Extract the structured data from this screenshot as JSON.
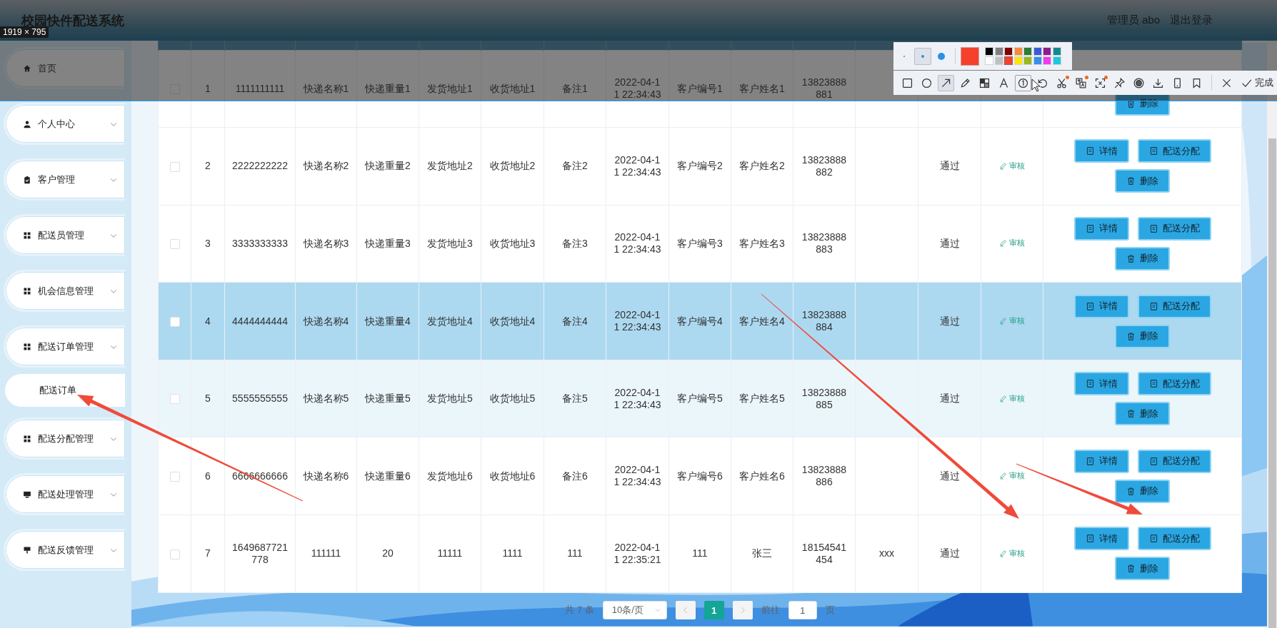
{
  "header": {
    "title": "校园快件配送系统",
    "user": "管理员 abo",
    "logout": "退出登录"
  },
  "sidebar": {
    "items": [
      {
        "label": "首页",
        "kind": "link"
      },
      {
        "label": "个人中心",
        "kind": "submenu"
      },
      {
        "label": "客户管理",
        "kind": "submenu"
      },
      {
        "label": "配送员管理",
        "kind": "submenu"
      },
      {
        "label": "机会信息管理",
        "kind": "submenu"
      },
      {
        "label": "配送订单管理",
        "kind": "submenu",
        "children": [
          {
            "label": "配送订单"
          }
        ]
      },
      {
        "label": "配送分配管理",
        "kind": "submenu"
      },
      {
        "label": "配送处理管理",
        "kind": "submenu"
      },
      {
        "label": "配送反馈管理",
        "kind": "submenu"
      }
    ]
  },
  "table": {
    "rows": [
      {
        "checked": false,
        "selected": false,
        "hover": false,
        "cells": [
          "1",
          "1111111111",
          "快递名称1",
          "快递重量1",
          "发货地址1",
          "收货地址1",
          "备注1",
          "2022-04-11 22:34:43",
          "客户编号1",
          "客户姓名1",
          "13823888881",
          null,
          null
        ],
        "actions": [
          {
            "label": "删除",
            "kind": "delete"
          }
        ]
      },
      {
        "checked": false,
        "selected": false,
        "hover": false,
        "cells": [
          "2",
          "2222222222",
          "快递名称2",
          "快递重量2",
          "发货地址2",
          "收货地址2",
          "备注2",
          "2022-04-11 22:34:43",
          "客户编号2",
          "客户姓名2",
          "13823888882",
          null,
          "通过"
        ],
        "review": "审核",
        "actions": [
          {
            "label": "详情",
            "kind": "detail"
          },
          {
            "label": "配送分配",
            "kind": "assign"
          },
          {
            "label": "删除",
            "kind": "delete"
          }
        ]
      },
      {
        "checked": false,
        "selected": false,
        "hover": false,
        "cells": [
          "3",
          "3333333333",
          "快递名称3",
          "快递重量3",
          "发货地址3",
          "收货地址3",
          "备注3",
          "2022-04-11 22:34:43",
          "客户编号3",
          "客户姓名3",
          "13823888883",
          null,
          "通过"
        ],
        "review": "审核",
        "actions": [
          {
            "label": "详情",
            "kind": "detail"
          },
          {
            "label": "配送分配",
            "kind": "assign"
          },
          {
            "label": "删除",
            "kind": "delete"
          }
        ]
      },
      {
        "checked": false,
        "selected": true,
        "hover": false,
        "cells": [
          "4",
          "4444444444",
          "快递名称4",
          "快递重量4",
          "发货地址4",
          "收货地址4",
          "备注4",
          "2022-04-11 22:34:43",
          "客户编号4",
          "客户姓名4",
          "13823888884",
          null,
          "通过"
        ],
        "review": "审核",
        "actions": [
          {
            "label": "详情",
            "kind": "detail"
          },
          {
            "label": "配送分配",
            "kind": "assign"
          },
          {
            "label": "删除",
            "kind": "delete"
          }
        ]
      },
      {
        "checked": false,
        "selected": false,
        "hover": true,
        "cells": [
          "5",
          "5555555555",
          "快递名称5",
          "快递重量5",
          "发货地址5",
          "收货地址5",
          "备注5",
          "2022-04-11 22:34:43",
          "客户编号5",
          "客户姓名5",
          "13823888885",
          null,
          "通过"
        ],
        "review": "审核",
        "actions": [
          {
            "label": "详情",
            "kind": "detail"
          },
          {
            "label": "配送分配",
            "kind": "assign"
          },
          {
            "label": "删除",
            "kind": "delete"
          }
        ]
      },
      {
        "checked": false,
        "selected": false,
        "hover": false,
        "cells": [
          "6",
          "6666666666",
          "快递名称6",
          "快递重量6",
          "发货地址6",
          "收货地址6",
          "备注6",
          "2022-04-11 22:34:43",
          "客户编号6",
          "客户姓名6",
          "13823888886",
          null,
          "通过"
        ],
        "review": "审核",
        "actions": [
          {
            "label": "详情",
            "kind": "detail"
          },
          {
            "label": "配送分配",
            "kind": "assign"
          },
          {
            "label": "删除",
            "kind": "delete"
          }
        ]
      },
      {
        "checked": false,
        "selected": false,
        "hover": false,
        "cells": [
          "7",
          "1649687721778",
          "111111",
          "20",
          "11111",
          "1111",
          "111",
          "2022-04-11 22:35:21",
          "111",
          "张三",
          "18154541454",
          "xxx",
          "通过"
        ],
        "review": "审核",
        "actions": [
          {
            "label": "详情",
            "kind": "detail"
          },
          {
            "label": "配送分配",
            "kind": "assign"
          },
          {
            "label": "删除",
            "kind": "delete"
          }
        ]
      }
    ]
  },
  "pagination": {
    "total": "共 7 条",
    "page_size": "10条/页",
    "pages": [
      {
        "label": "1",
        "selected": true
      }
    ],
    "goto_label": "前往",
    "goto_value": "1",
    "goto_suffix": "页"
  },
  "capture": {
    "size_label": "1919 × 795",
    "sizes": [
      {
        "selected": false
      },
      {
        "selected": true
      },
      {
        "selected": false
      }
    ],
    "palette": [
      {
        "color": "#000000",
        "selected": false
      },
      {
        "color": "#808080",
        "selected": false
      },
      {
        "color": "#800000",
        "selected": false
      },
      {
        "color": "#f78b3a",
        "selected": false
      },
      {
        "color": "#2e7d32",
        "selected": false
      },
      {
        "color": "#3a5bd9",
        "selected": false
      },
      {
        "color": "#8e1c8e",
        "selected": false
      },
      {
        "color": "#118a8f",
        "selected": false
      },
      {
        "color": "#ffffff",
        "selected": false
      },
      {
        "color": "#c0c0c0",
        "selected": false
      },
      {
        "color": "#f5402c",
        "selected": true
      },
      {
        "color": "#ffe600",
        "selected": false
      },
      {
        "color": "#99b81c",
        "selected": false
      },
      {
        "color": "#3a8ee6",
        "selected": false
      },
      {
        "color": "#f23af2",
        "selected": false
      },
      {
        "color": "#1ec8dc",
        "selected": false
      }
    ],
    "tools": [
      {
        "selected": false,
        "badge": false
      },
      {
        "selected": false,
        "badge": false
      },
      {
        "selected": true,
        "badge": false
      },
      {
        "selected": false,
        "badge": false
      },
      {
        "selected": false,
        "badge": false
      },
      {
        "selected": false,
        "badge": false
      },
      {
        "selected": false,
        "badge": false
      },
      {
        "selected": false,
        "badge": false
      },
      {
        "selected": false,
        "badge": true
      },
      {
        "selected": false,
        "badge": true
      },
      {
        "selected": false,
        "badge": true
      },
      {
        "selected": false,
        "badge": false
      },
      {
        "selected": false,
        "badge": false
      },
      {
        "selected": false,
        "badge": false
      },
      {
        "selected": false,
        "badge": false
      },
      {
        "selected": false,
        "badge": false
      },
      {
        "selected": false,
        "badge": false
      }
    ],
    "done": "完成",
    "arrows": [
      {
        "color": "#f04a3a"
      },
      {
        "color": "#f04a3a"
      },
      {
        "color": "#f04a3a"
      }
    ]
  }
}
